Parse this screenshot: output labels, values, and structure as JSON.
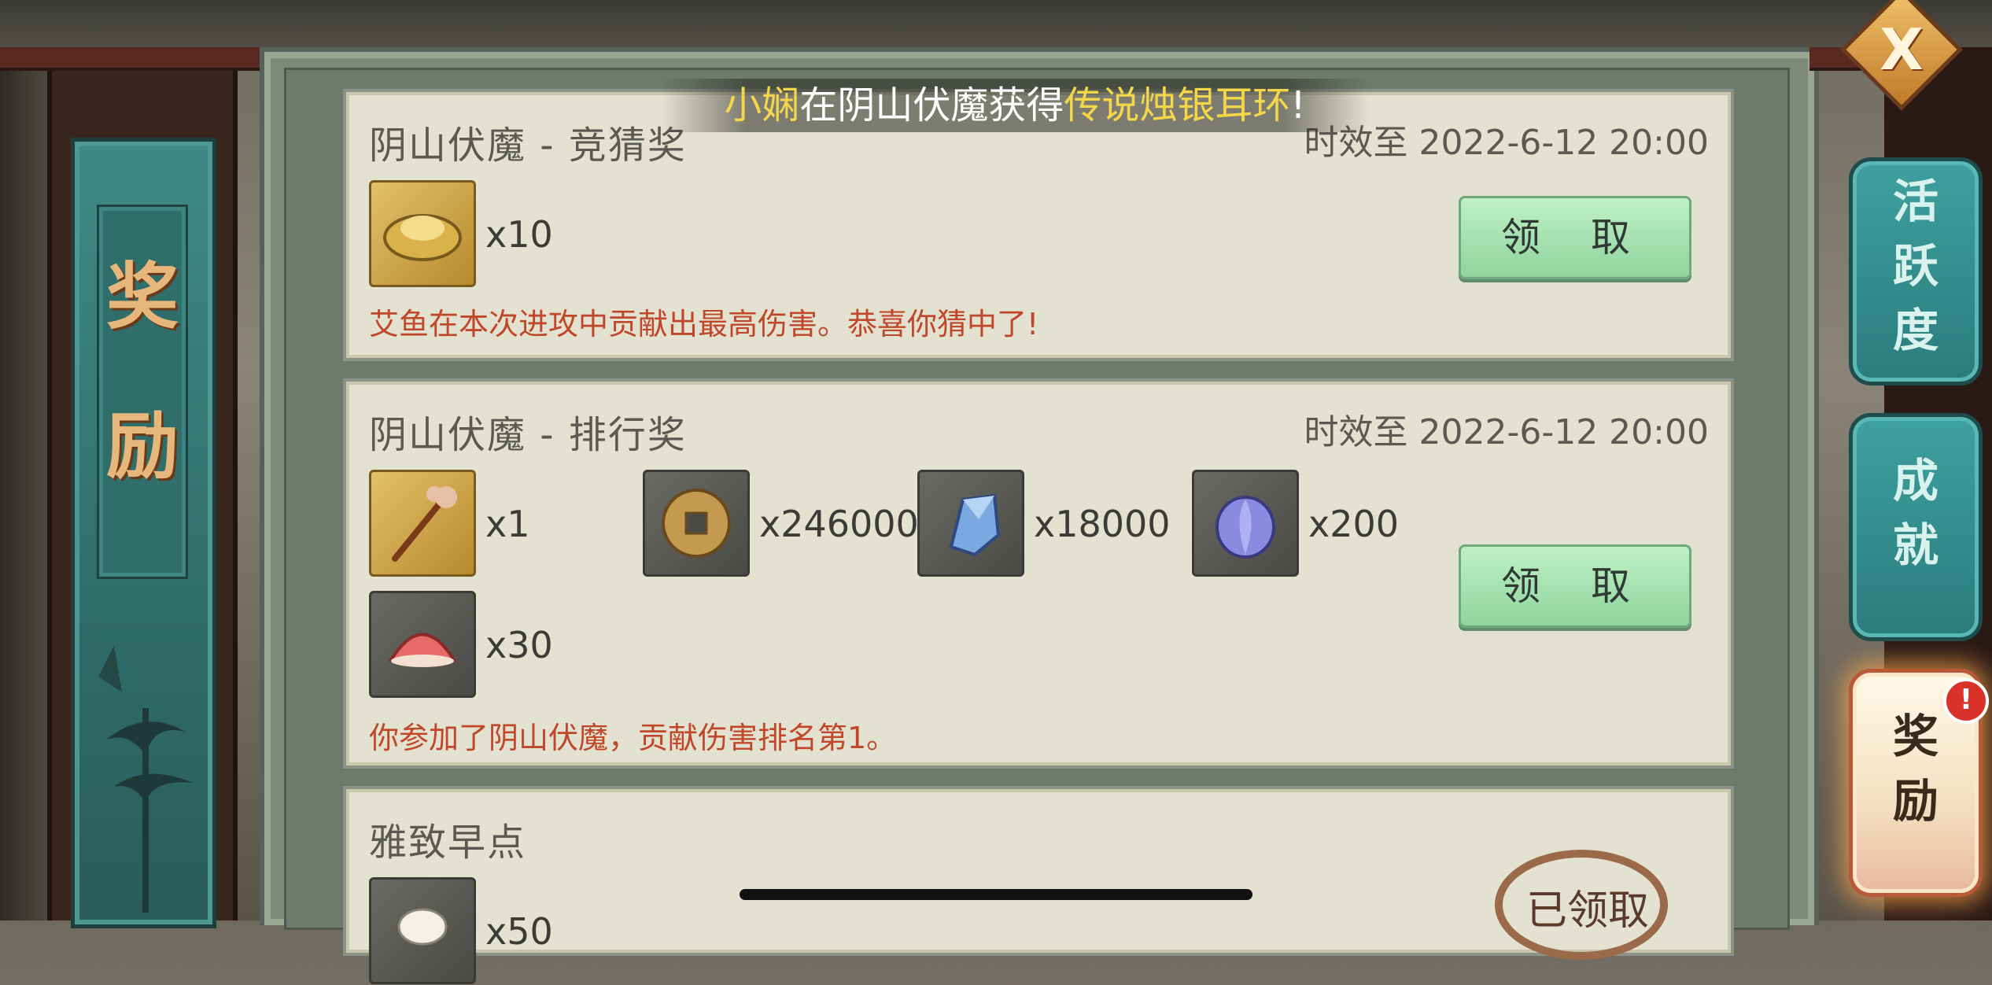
{
  "left_banner": {
    "chars": [
      "奖",
      "励"
    ]
  },
  "ticker": {
    "player": "小娴",
    "middle": "在阴山伏魔获得",
    "item": "传说烛银耳环",
    "end": "!"
  },
  "cards": [
    {
      "title": "阴山伏魔  -  竞猜奖",
      "time_label": "时效至  2022-6-12  20:00",
      "items": [
        {
          "icon": "gold-ingot-icon",
          "qty": "x10"
        }
      ],
      "note": "艾鱼在本次进攻中贡献出最高伤害。恭喜你猜中了!",
      "button": "领 取"
    },
    {
      "title": "阴山伏魔  -  排行奖",
      "time_label": "时效至  2022-6-12  20:00",
      "items": [
        {
          "icon": "hairpin-icon",
          "qty": "x1"
        },
        {
          "icon": "copper-coin-icon",
          "qty": "x246000"
        },
        {
          "icon": "blue-crystal-icon",
          "qty": "x18000"
        },
        {
          "icon": "purple-bud-icon",
          "qty": "x200"
        },
        {
          "icon": "red-cake-icon",
          "qty": "x30"
        }
      ],
      "note": "你参加了阴山伏魔，贡献伤害排名第1。",
      "button": "领 取"
    },
    {
      "title": "雅致早点",
      "items": [
        {
          "icon": "steamed-bun-icon",
          "qty": "x50"
        }
      ],
      "stamp": "已领取"
    }
  ],
  "right_nav": [
    {
      "label": "活跃度",
      "active": false
    },
    {
      "label": "成就",
      "active": false
    },
    {
      "label": "奖励",
      "active": true
    }
  ],
  "close_glyph": "X",
  "badge": "!",
  "colors": {
    "accent_green": "#8fd49e",
    "note_red": "#c0472a",
    "ticker_yellow": "#f3d64a"
  }
}
